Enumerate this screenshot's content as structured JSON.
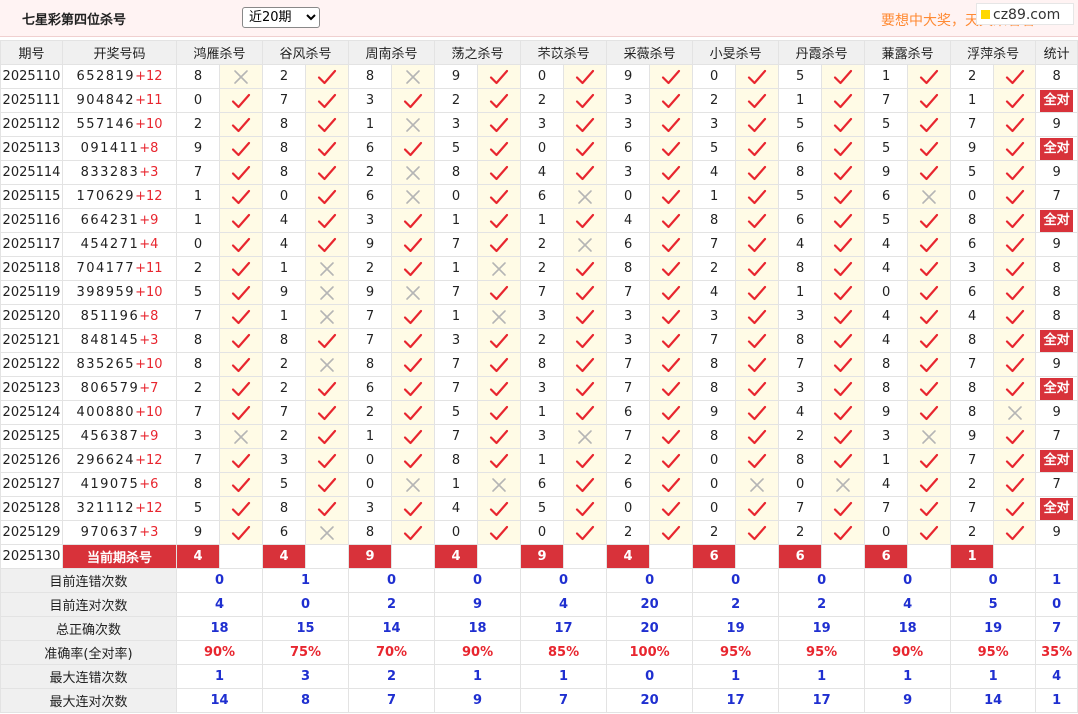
{
  "header": {
    "title": "七星彩第四位杀号",
    "period_option": "近20期",
    "promo": "要想中大奖，天天来看看",
    "logo": "cz89.com"
  },
  "columns": {
    "issue": "期号",
    "draw": "开奖号码",
    "experts": [
      "鸿雁杀号",
      "谷风杀号",
      "周南杀号",
      "荡之杀号",
      "芣苡杀号",
      "采薇杀号",
      "小旻杀号",
      "丹霞杀号",
      "蒹露杀号",
      "浮萍杀号"
    ],
    "stats": "统计"
  },
  "rows": [
    {
      "issue": "2025110",
      "digits": "652819",
      "sum": "+12",
      "nums": [
        "8",
        "2",
        "8",
        "9",
        "0",
        "9",
        "0",
        "5",
        "1",
        "2"
      ],
      "ok": [
        0,
        1,
        0,
        1,
        1,
        1,
        1,
        1,
        1,
        1
      ],
      "stat": "8"
    },
    {
      "issue": "2025111",
      "digits": "904842",
      "sum": "+11",
      "nums": [
        "0",
        "7",
        "3",
        "2",
        "2",
        "3",
        "2",
        "1",
        "7",
        "1"
      ],
      "ok": [
        1,
        1,
        1,
        1,
        1,
        1,
        1,
        1,
        1,
        1
      ],
      "stat": "全对"
    },
    {
      "issue": "2025112",
      "digits": "557146",
      "sum": "+10",
      "nums": [
        "2",
        "8",
        "1",
        "3",
        "3",
        "3",
        "3",
        "5",
        "5",
        "7"
      ],
      "ok": [
        1,
        1,
        0,
        1,
        1,
        1,
        1,
        1,
        1,
        1
      ],
      "stat": "9"
    },
    {
      "issue": "2025113",
      "digits": "091411",
      "sum": "+8",
      "nums": [
        "9",
        "8",
        "6",
        "5",
        "0",
        "6",
        "5",
        "6",
        "5",
        "9"
      ],
      "ok": [
        1,
        1,
        1,
        1,
        1,
        1,
        1,
        1,
        1,
        1
      ],
      "stat": "全对"
    },
    {
      "issue": "2025114",
      "digits": "833283",
      "sum": "+3",
      "nums": [
        "7",
        "8",
        "2",
        "8",
        "4",
        "3",
        "4",
        "8",
        "9",
        "5"
      ],
      "ok": [
        1,
        1,
        0,
        1,
        1,
        1,
        1,
        1,
        1,
        1
      ],
      "stat": "9"
    },
    {
      "issue": "2025115",
      "digits": "170629",
      "sum": "+12",
      "nums": [
        "1",
        "0",
        "6",
        "0",
        "6",
        "0",
        "1",
        "5",
        "6",
        "0"
      ],
      "ok": [
        1,
        1,
        0,
        1,
        0,
        1,
        1,
        1,
        0,
        1
      ],
      "stat": "7"
    },
    {
      "issue": "2025116",
      "digits": "664231",
      "sum": "+9",
      "nums": [
        "1",
        "4",
        "3",
        "1",
        "1",
        "4",
        "8",
        "6",
        "5",
        "8"
      ],
      "ok": [
        1,
        1,
        1,
        1,
        1,
        1,
        1,
        1,
        1,
        1
      ],
      "stat": "全对"
    },
    {
      "issue": "2025117",
      "digits": "454271",
      "sum": "+4",
      "nums": [
        "0",
        "4",
        "9",
        "7",
        "2",
        "6",
        "7",
        "4",
        "4",
        "6"
      ],
      "ok": [
        1,
        1,
        1,
        1,
        0,
        1,
        1,
        1,
        1,
        1
      ],
      "stat": "9"
    },
    {
      "issue": "2025118",
      "digits": "704177",
      "sum": "+11",
      "nums": [
        "2",
        "1",
        "2",
        "1",
        "2",
        "8",
        "2",
        "8",
        "4",
        "3"
      ],
      "ok": [
        1,
        0,
        1,
        0,
        1,
        1,
        1,
        1,
        1,
        1
      ],
      "stat": "8"
    },
    {
      "issue": "2025119",
      "digits": "398959",
      "sum": "+10",
      "nums": [
        "5",
        "9",
        "9",
        "7",
        "7",
        "7",
        "4",
        "1",
        "0",
        "6"
      ],
      "ok": [
        1,
        0,
        0,
        1,
        1,
        1,
        1,
        1,
        1,
        1
      ],
      "stat": "8"
    },
    {
      "issue": "2025120",
      "digits": "851196",
      "sum": "+8",
      "nums": [
        "7",
        "1",
        "7",
        "1",
        "3",
        "3",
        "3",
        "3",
        "4",
        "4"
      ],
      "ok": [
        1,
        0,
        1,
        0,
        1,
        1,
        1,
        1,
        1,
        1
      ],
      "stat": "8"
    },
    {
      "issue": "2025121",
      "digits": "848145",
      "sum": "+3",
      "nums": [
        "8",
        "8",
        "7",
        "3",
        "2",
        "3",
        "7",
        "8",
        "4",
        "8"
      ],
      "ok": [
        1,
        1,
        1,
        1,
        1,
        1,
        1,
        1,
        1,
        1
      ],
      "stat": "全对"
    },
    {
      "issue": "2025122",
      "digits": "835265",
      "sum": "+10",
      "nums": [
        "8",
        "2",
        "8",
        "7",
        "8",
        "7",
        "8",
        "7",
        "8",
        "7"
      ],
      "ok": [
        1,
        0,
        1,
        1,
        1,
        1,
        1,
        1,
        1,
        1
      ],
      "stat": "9"
    },
    {
      "issue": "2025123",
      "digits": "806579",
      "sum": "+7",
      "nums": [
        "2",
        "2",
        "6",
        "7",
        "3",
        "7",
        "8",
        "3",
        "8",
        "8"
      ],
      "ok": [
        1,
        1,
        1,
        1,
        1,
        1,
        1,
        1,
        1,
        1
      ],
      "stat": "全对"
    },
    {
      "issue": "2025124",
      "digits": "400880",
      "sum": "+10",
      "nums": [
        "7",
        "7",
        "2",
        "5",
        "1",
        "6",
        "9",
        "4",
        "9",
        "8"
      ],
      "ok": [
        1,
        1,
        1,
        1,
        1,
        1,
        1,
        1,
        1,
        0
      ],
      "stat": "9"
    },
    {
      "issue": "2025125",
      "digits": "456387",
      "sum": "+9",
      "nums": [
        "3",
        "2",
        "1",
        "7",
        "3",
        "7",
        "8",
        "2",
        "3",
        "9"
      ],
      "ok": [
        0,
        1,
        1,
        1,
        0,
        1,
        1,
        1,
        0,
        1
      ],
      "stat": "7"
    },
    {
      "issue": "2025126",
      "digits": "296624",
      "sum": "+12",
      "nums": [
        "7",
        "3",
        "0",
        "8",
        "1",
        "2",
        "0",
        "8",
        "1",
        "7"
      ],
      "ok": [
        1,
        1,
        1,
        1,
        1,
        1,
        1,
        1,
        1,
        1
      ],
      "stat": "全对"
    },
    {
      "issue": "2025127",
      "digits": "419075",
      "sum": "+6",
      "nums": [
        "8",
        "5",
        "0",
        "1",
        "6",
        "6",
        "0",
        "0",
        "4",
        "2"
      ],
      "ok": [
        1,
        1,
        0,
        0,
        1,
        1,
        0,
        0,
        1,
        1
      ],
      "stat": "7"
    },
    {
      "issue": "2025128",
      "digits": "321112",
      "sum": "+12",
      "nums": [
        "5",
        "8",
        "3",
        "4",
        "5",
        "0",
        "0",
        "7",
        "7",
        "7"
      ],
      "ok": [
        1,
        1,
        1,
        1,
        1,
        1,
        1,
        1,
        1,
        1
      ],
      "stat": "全对"
    },
    {
      "issue": "2025129",
      "digits": "970637",
      "sum": "+3",
      "nums": [
        "9",
        "6",
        "8",
        "0",
        "0",
        "2",
        "2",
        "2",
        "0",
        "2"
      ],
      "ok": [
        1,
        0,
        1,
        1,
        1,
        1,
        1,
        1,
        1,
        1
      ],
      "stat": "9"
    }
  ],
  "current": {
    "issue": "2025130",
    "label": "当前期杀号",
    "kills": [
      "4",
      "4",
      "9",
      "4",
      "9",
      "4",
      "6",
      "6",
      "6",
      "1"
    ]
  },
  "stats": [
    {
      "label": "目前连错次数",
      "kind": "val",
      "values": [
        "0",
        "1",
        "0",
        "0",
        "0",
        "0",
        "0",
        "0",
        "0",
        "0"
      ],
      "total": "1"
    },
    {
      "label": "目前连对次数",
      "kind": "val",
      "values": [
        "4",
        "0",
        "2",
        "9",
        "4",
        "20",
        "2",
        "2",
        "4",
        "5"
      ],
      "total": "0"
    },
    {
      "label": "总正确次数",
      "kind": "val",
      "values": [
        "18",
        "15",
        "14",
        "18",
        "17",
        "20",
        "19",
        "19",
        "18",
        "19"
      ],
      "total": "7"
    },
    {
      "label": "准确率(全对率)",
      "kind": "pct",
      "values": [
        "90%",
        "75%",
        "70%",
        "90%",
        "85%",
        "100%",
        "95%",
        "95%",
        "90%",
        "95%"
      ],
      "total": "35%"
    },
    {
      "label": "最大连错次数",
      "kind": "val",
      "values": [
        "1",
        "3",
        "2",
        "1",
        "1",
        "0",
        "1",
        "1",
        "1",
        "1"
      ],
      "total": "4"
    },
    {
      "label": "最大连对次数",
      "kind": "val",
      "values": [
        "14",
        "8",
        "7",
        "9",
        "7",
        "20",
        "17",
        "17",
        "9",
        "14"
      ],
      "total": "1"
    }
  ],
  "icons": {
    "correct": "check-icon",
    "wrong": "cross-icon"
  },
  "colors": {
    "check": "#e8262f",
    "cross": "#b5b5b5",
    "accent": "#d8323a",
    "stat_blue": "#1f2fd0",
    "promo": "#ff8a33"
  }
}
